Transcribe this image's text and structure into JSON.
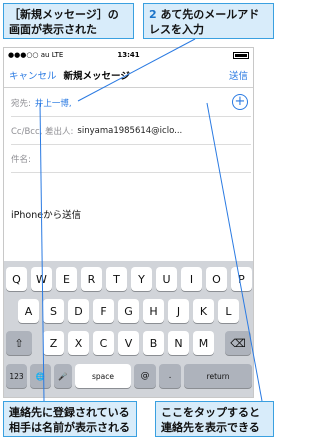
{
  "callouts": {
    "top_left": "［新規メッセージ］の画面が表示された",
    "top_right_num": "2",
    "top_right_text": "あて先のメールアドレスを入力",
    "bottom_left": "連絡先に登録されている相手は名前が表示される",
    "bottom_right": "ここをタップすると連絡先を表示できる"
  },
  "status_bar": {
    "carrier": "●●●○○ au  LTE",
    "time": "13:41"
  },
  "nav": {
    "cancel": "キャンセル",
    "title": "新規メッセージ",
    "send": "送信"
  },
  "fields": {
    "to_label": "宛先:",
    "to_value": "井上一博,",
    "cc_label": "Cc/Bcc, 差出人:",
    "cc_value": "sinyama1985614@iclo...",
    "subject_label": "件名:"
  },
  "body_text": "iPhoneから送信",
  "keyboard": {
    "row1": [
      "Q",
      "W",
      "E",
      "R",
      "T",
      "Y",
      "U",
      "I",
      "O",
      "P"
    ],
    "row2": [
      "A",
      "S",
      "D",
      "F",
      "G",
      "H",
      "J",
      "K",
      "L"
    ],
    "row3": [
      "Z",
      "X",
      "C",
      "V",
      "B",
      "N",
      "M"
    ],
    "shift": "⇧",
    "delete": "⌫",
    "num": "123",
    "globe": "🌐",
    "mic": "🎤",
    "space": "space",
    "at": "@",
    "dot": ".",
    "return": "return"
  },
  "colors": {
    "accent": "#2a7ae2",
    "callout_bg": "#d8ecfa",
    "callout_border": "#3aa0e0"
  }
}
